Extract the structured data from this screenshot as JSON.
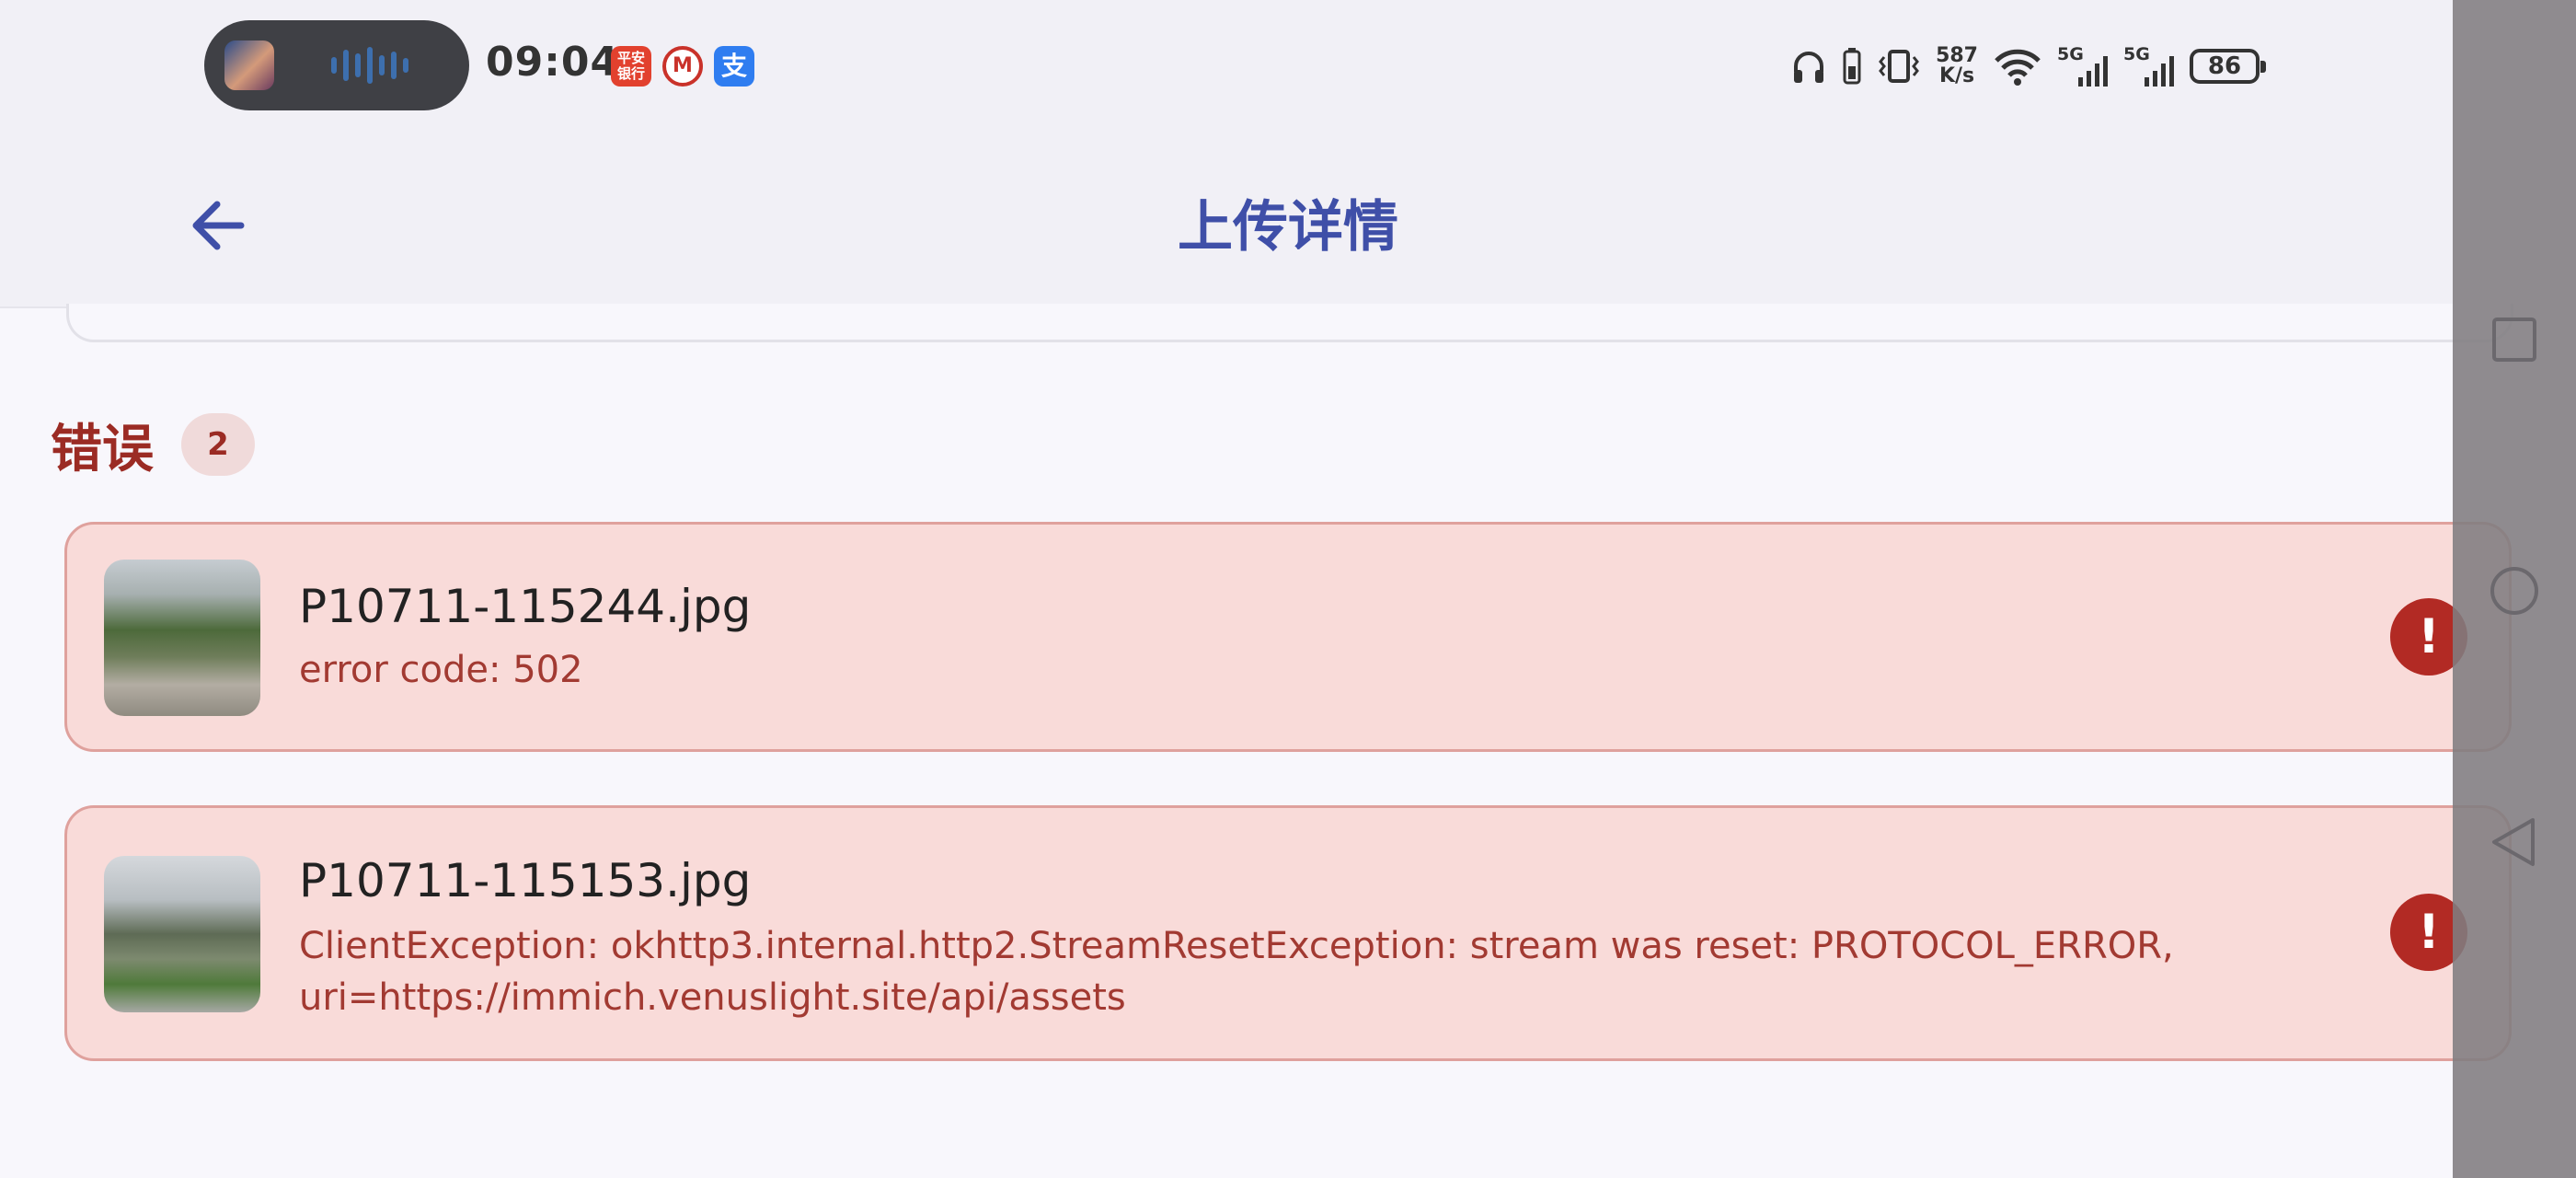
{
  "status_bar": {
    "time": "09:04",
    "app_icons": [
      {
        "name": "ping-an-bank-icon",
        "glyph": "平安\n银行"
      },
      {
        "name": "metro-icon",
        "glyph": "M"
      },
      {
        "name": "alipay-icon",
        "glyph": "支"
      }
    ],
    "net_speed_value": "587",
    "net_speed_unit": "K/s",
    "signal_label_1": "5G",
    "signal_label_2": "5G",
    "battery": "86"
  },
  "app_bar": {
    "title": "上传详情",
    "back_icon": "arrow-left-icon"
  },
  "errors": {
    "title": "错误",
    "count": "2",
    "items": [
      {
        "file_name": "P10711-115244.jpg",
        "message": "error code: 502",
        "status_icon": "error-icon"
      },
      {
        "file_name": "P10711-115153.jpg",
        "message": "ClientException: okhttp3.internal.http2.StreamResetException: stream was reset: PROTOCOL_ERROR, uri=https://immich.venuslight.site/api/assets",
        "status_icon": "error-icon"
      }
    ]
  },
  "nav_bar": {
    "buttons": [
      "recents-icon",
      "home-icon",
      "back-triangle-icon"
    ]
  },
  "colors": {
    "accent": "#3f4fa8",
    "error": "#9b2b24",
    "error_card_bg": "#f9dbd9"
  }
}
